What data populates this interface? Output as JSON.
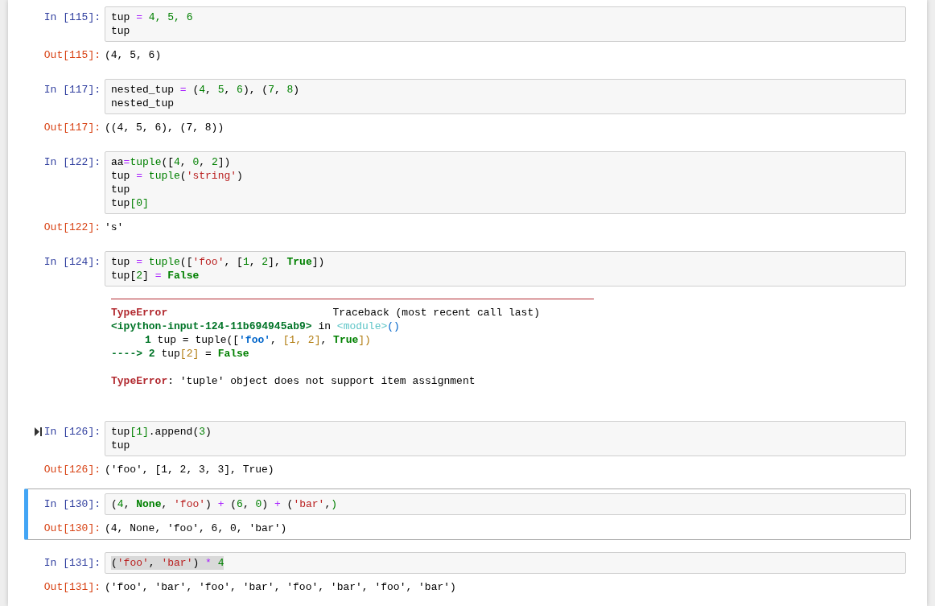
{
  "cells": [
    {
      "selected": false,
      "marker": false,
      "in_prompt": "In [115]:",
      "input": [
        {
          "highlighted": false,
          "tokens": [
            {
              "kind": "name",
              "text": "tup "
            },
            {
              "kind": "op",
              "text": "="
            },
            {
              "kind": "num",
              "text": " 4, 5, 6"
            }
          ]
        },
        {
          "highlighted": false,
          "tokens": [
            {
              "kind": "name",
              "text": "tup"
            }
          ]
        }
      ],
      "output": {
        "kind": "result",
        "prompt": "Out[115]:",
        "text": "(4, 5, 6)"
      }
    },
    {
      "selected": false,
      "marker": false,
      "in_prompt": "In [117]:",
      "input": [
        {
          "highlighted": false,
          "tokens": [
            {
              "kind": "name",
              "text": "nested_tup "
            },
            {
              "kind": "op",
              "text": "="
            },
            {
              "kind": "name",
              "text": " ("
            },
            {
              "kind": "num",
              "text": "4"
            },
            {
              "kind": "name",
              "text": ", "
            },
            {
              "kind": "num",
              "text": "5"
            },
            {
              "kind": "name",
              "text": ", "
            },
            {
              "kind": "num",
              "text": "6"
            },
            {
              "kind": "name",
              "text": "), ("
            },
            {
              "kind": "num",
              "text": "7"
            },
            {
              "kind": "name",
              "text": ", "
            },
            {
              "kind": "num",
              "text": "8"
            },
            {
              "kind": "name",
              "text": ")"
            }
          ]
        },
        {
          "highlighted": false,
          "tokens": [
            {
              "kind": "name",
              "text": "nested_tup"
            }
          ]
        }
      ],
      "output": {
        "kind": "result",
        "prompt": "Out[117]:",
        "text": "((4, 5, 6), (7, 8))"
      }
    },
    {
      "selected": false,
      "marker": false,
      "in_prompt": "In [122]:",
      "input": [
        {
          "highlighted": false,
          "tokens": [
            {
              "kind": "name",
              "text": "aa"
            },
            {
              "kind": "op",
              "text": "="
            },
            {
              "kind": "builtin",
              "text": "tuple"
            },
            {
              "kind": "name",
              "text": "(["
            },
            {
              "kind": "num",
              "text": "4"
            },
            {
              "kind": "name",
              "text": ", "
            },
            {
              "kind": "num",
              "text": "0"
            },
            {
              "kind": "name",
              "text": ", "
            },
            {
              "kind": "num",
              "text": "2"
            },
            {
              "kind": "name",
              "text": "])"
            }
          ]
        },
        {
          "highlighted": false,
          "tokens": [
            {
              "kind": "name",
              "text": "tup "
            },
            {
              "kind": "op",
              "text": "="
            },
            {
              "kind": "builtin",
              "text": " tuple"
            },
            {
              "kind": "name",
              "text": "("
            },
            {
              "kind": "str",
              "text": "'string'"
            },
            {
              "kind": "name",
              "text": ")"
            }
          ]
        },
        {
          "highlighted": false,
          "tokens": [
            {
              "kind": "name",
              "text": "tup"
            }
          ]
        },
        {
          "highlighted": false,
          "tokens": [
            {
              "kind": "name",
              "text": "tup"
            },
            {
              "kind": "num",
              "text": "[0]"
            }
          ]
        }
      ],
      "output": {
        "kind": "result",
        "prompt": "Out[122]:",
        "text": "'s'"
      }
    },
    {
      "selected": false,
      "marker": false,
      "in_prompt": "In [124]:",
      "input": [
        {
          "highlighted": false,
          "tokens": [
            {
              "kind": "name",
              "text": "tup "
            },
            {
              "kind": "op",
              "text": "="
            },
            {
              "kind": "builtin",
              "text": " tuple"
            },
            {
              "kind": "name",
              "text": "(["
            },
            {
              "kind": "str",
              "text": "'foo'"
            },
            {
              "kind": "name",
              "text": ", ["
            },
            {
              "kind": "num",
              "text": "1"
            },
            {
              "kind": "name",
              "text": ", "
            },
            {
              "kind": "num",
              "text": "2"
            },
            {
              "kind": "name",
              "text": "], "
            },
            {
              "kind": "kw",
              "text": "True"
            },
            {
              "kind": "name",
              "text": "])"
            }
          ]
        },
        {
          "highlighted": false,
          "tokens": [
            {
              "kind": "name",
              "text": "tup["
            },
            {
              "kind": "num",
              "text": "2"
            },
            {
              "kind": "name",
              "text": "] "
            },
            {
              "kind": "op",
              "text": "="
            },
            {
              "kind": "kw",
              "text": " False"
            }
          ]
        }
      ],
      "output": {
        "kind": "error",
        "lines": [
          {
            "kind": "header",
            "tokens": [
              {
                "kind": "ename",
                "text": "TypeError"
              },
              {
                "kind": "name",
                "text": "Traceback (most recent call last)"
              }
            ]
          },
          {
            "kind": "code",
            "tokens": [
              {
                "kind": "file",
                "text": "<ipython-input-124-11b694945ab9>"
              },
              {
                "kind": "name",
                "text": " in "
              },
              {
                "kind": "module",
                "text": "<module>"
              },
              {
                "kind": "paren",
                "text": "()"
              }
            ]
          },
          {
            "kind": "context",
            "tokens": [
              {
                "kind": "lineno",
                "text": "1"
              },
              {
                "kind": "name",
                "text": " tup = tuple(["
              },
              {
                "kind": "tbstr",
                "text": "'foo'"
              },
              {
                "kind": "name",
                "text": ", "
              },
              {
                "kind": "tbbracket",
                "text": "[1, 2]"
              },
              {
                "kind": "name",
                "text": ", "
              },
              {
                "kind": "kw",
                "text": "True"
              },
              {
                "kind": "tbbracket",
                "text": "])"
              }
            ]
          },
          {
            "kind": "code",
            "tokens": [
              {
                "kind": "lineno",
                "text": "----> 2"
              },
              {
                "kind": "name",
                "text": " tup"
              },
              {
                "kind": "tbbracket",
                "text": "[2]"
              },
              {
                "kind": "name",
                "text": " = "
              },
              {
                "kind": "kw",
                "text": "False"
              }
            ]
          },
          {
            "kind": "blank"
          },
          {
            "kind": "code",
            "tokens": [
              {
                "kind": "ename",
                "text": "TypeError"
              },
              {
                "kind": "name",
                "text": ": 'tuple' object does not support item assignment"
              }
            ]
          }
        ]
      }
    },
    {
      "selected": false,
      "marker": true,
      "in_prompt": "In [126]:",
      "input": [
        {
          "highlighted": false,
          "tokens": [
            {
              "kind": "name",
              "text": "tup"
            },
            {
              "kind": "num",
              "text": "[1]"
            },
            {
              "kind": "name",
              "text": ".append("
            },
            {
              "kind": "num",
              "text": "3"
            },
            {
              "kind": "name",
              "text": ")"
            }
          ]
        },
        {
          "highlighted": false,
          "tokens": [
            {
              "kind": "name",
              "text": "tup"
            }
          ]
        }
      ],
      "output": {
        "kind": "result",
        "prompt": "Out[126]:",
        "text": "('foo', [1, 2, 3, 3], True)"
      }
    },
    {
      "selected": true,
      "marker": false,
      "in_prompt": "In [130]:",
      "input": [
        {
          "highlighted": false,
          "tokens": [
            {
              "kind": "name",
              "text": "("
            },
            {
              "kind": "num",
              "text": "4"
            },
            {
              "kind": "name",
              "text": ", "
            },
            {
              "kind": "kw",
              "text": "None"
            },
            {
              "kind": "name",
              "text": ", "
            },
            {
              "kind": "str",
              "text": "'foo'"
            },
            {
              "kind": "name",
              "text": ") "
            },
            {
              "kind": "op",
              "text": "+"
            },
            {
              "kind": "name",
              "text": " ("
            },
            {
              "kind": "num",
              "text": "6"
            },
            {
              "kind": "name",
              "text": ", "
            },
            {
              "kind": "num",
              "text": "0"
            },
            {
              "kind": "name",
              "text": ") "
            },
            {
              "kind": "op",
              "text": "+"
            },
            {
              "kind": "name",
              "text": " ("
            },
            {
              "kind": "str",
              "text": "'bar'"
            },
            {
              "kind": "name",
              "text": ","
            },
            {
              "kind": "num",
              "text": ")"
            }
          ]
        }
      ],
      "output": {
        "kind": "result",
        "prompt": "Out[130]:",
        "text": "(4, None, 'foo', 6, 0, 'bar')"
      }
    },
    {
      "selected": false,
      "marker": false,
      "in_prompt": "In [131]:",
      "input": [
        {
          "highlighted": true,
          "tokens": [
            {
              "kind": "name",
              "text": "("
            },
            {
              "kind": "str",
              "text": "'foo'"
            },
            {
              "kind": "name",
              "text": ", "
            },
            {
              "kind": "str",
              "text": "'bar'"
            },
            {
              "kind": "name",
              "text": ") "
            },
            {
              "kind": "op",
              "text": "*"
            },
            {
              "kind": "num",
              "text": " 4"
            }
          ]
        }
      ],
      "output": {
        "kind": "result",
        "prompt": "Out[131]:",
        "text": "('foo', 'bar', 'foo', 'bar', 'foo', 'bar', 'foo', 'bar')"
      }
    }
  ]
}
